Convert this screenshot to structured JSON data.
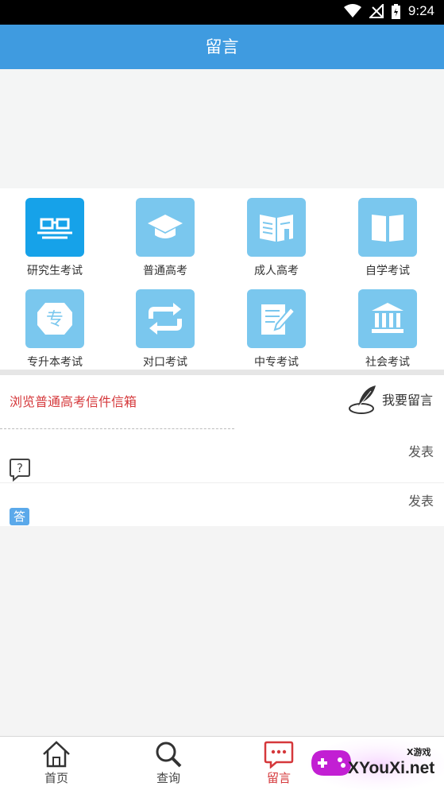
{
  "status_bar": {
    "time": "9:24"
  },
  "header": {
    "title": "留言"
  },
  "categories": [
    {
      "label": "研究生考试",
      "icon": "glasses-icon"
    },
    {
      "label": "普通高考",
      "icon": "graduation-cap-icon"
    },
    {
      "label": "成人高考",
      "icon": "open-book-hand-icon"
    },
    {
      "label": "自学考试",
      "icon": "book-icon"
    },
    {
      "label": "专升本考试",
      "icon": "zhuan-badge-icon"
    },
    {
      "label": "对口考试",
      "icon": "swap-arrows-icon"
    },
    {
      "label": "中专考试",
      "icon": "edit-document-icon"
    },
    {
      "label": "社会考试",
      "icon": "institution-icon"
    }
  ],
  "messages": {
    "browse_link": "浏览普通高考信件信箱",
    "leave_message": "我要留言",
    "rows": [
      {
        "icon": "question-icon",
        "action": "发表"
      },
      {
        "icon_text": "答",
        "action": "发表"
      }
    ]
  },
  "tabbar": {
    "tabs": [
      {
        "label": "首页",
        "icon": "home-icon"
      },
      {
        "label": "查询",
        "icon": "search-icon"
      },
      {
        "label": "留言",
        "icon": "message-icon"
      }
    ],
    "active": "留言"
  },
  "watermark": {
    "text": "XYouXi.net",
    "small": "X游戏"
  },
  "colors": {
    "header": "#3f9be0",
    "accent_red": "#d5383b",
    "tile": "#7ac7ee",
    "tile_active": "#16a2e9"
  }
}
